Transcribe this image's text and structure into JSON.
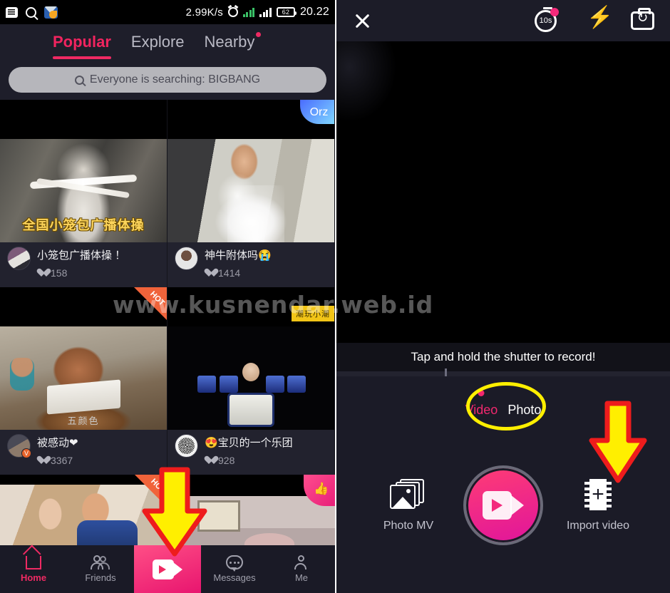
{
  "statusbar": {
    "icons": [
      "bbm-icon",
      "search-icon",
      "mail-icon"
    ],
    "network_speed": "2.99K/s",
    "alarm_icon": "alarm-icon",
    "battery_level": "62",
    "time": "20.22"
  },
  "feed": {
    "tabs": [
      {
        "label": "Popular",
        "active": true,
        "dot": false
      },
      {
        "label": "Explore",
        "active": false,
        "dot": false
      },
      {
        "label": "Nearby",
        "active": false,
        "dot": true
      }
    ],
    "search": {
      "icon": "search-icon",
      "placeholder": "Everyone is searching: BIGBANG"
    },
    "cards": [
      {
        "caption_overlay": "全国小笼包广播体操",
        "badge": "",
        "title": "小笼包广播体操 ！",
        "likes": "158"
      },
      {
        "caption_overlay": "",
        "badge": "Orz",
        "title": "神牛附体吗😭",
        "likes": "1414"
      },
      {
        "caption_overlay": "五颜色",
        "badge": "HOT",
        "title": "被感动❤",
        "likes": "3367"
      },
      {
        "caption_overlay": "",
        "badge": "潮玩小潮",
        "title": "😍宝贝的一个乐团",
        "likes": "928"
      }
    ],
    "nav": [
      {
        "label": "Home",
        "icon": "home-icon",
        "active": true
      },
      {
        "label": "Friends",
        "icon": "friends-icon",
        "active": false
      },
      {
        "label": "",
        "icon": "video-camera-icon",
        "active": false
      },
      {
        "label": "Messages",
        "icon": "message-icon",
        "active": false
      },
      {
        "label": "Me",
        "icon": "person-icon",
        "active": false
      }
    ]
  },
  "camera": {
    "topbar": {
      "close_icon": "close-icon",
      "timer_label": "10s",
      "timer_icon": "timer-icon",
      "flash_icon": "flash-icon",
      "flip_icon": "camera-flip-icon"
    },
    "hint": "Tap and hold the shutter to record!",
    "modes": [
      {
        "label": "Video",
        "active": true,
        "highlighted": true
      },
      {
        "label": "Photo",
        "active": false,
        "highlighted": false
      }
    ],
    "bottom": [
      {
        "label": "Photo MV",
        "icon": "photo-stack-icon"
      },
      {
        "label": "",
        "icon": "shutter-video-icon"
      },
      {
        "label": "Import video",
        "icon": "film-plus-icon"
      }
    ]
  },
  "annotations": {
    "arrow_color": "#ffef00",
    "arrow_outline": "#ee1c1c",
    "ellipse_color": "#ffef00",
    "arrows": [
      "arrow-to-record-tab",
      "arrow-to-import-video"
    ],
    "ellipse": "ellipse-around-video-mode"
  },
  "watermark": "www.kusnendar.web.id",
  "colors": {
    "accent_pink": "#ef2a63",
    "panel_bg": "#1b1b27",
    "status_bg": "#000000",
    "hot_badge": "#f0633a",
    "highlight_yellow": "#ffef00"
  }
}
